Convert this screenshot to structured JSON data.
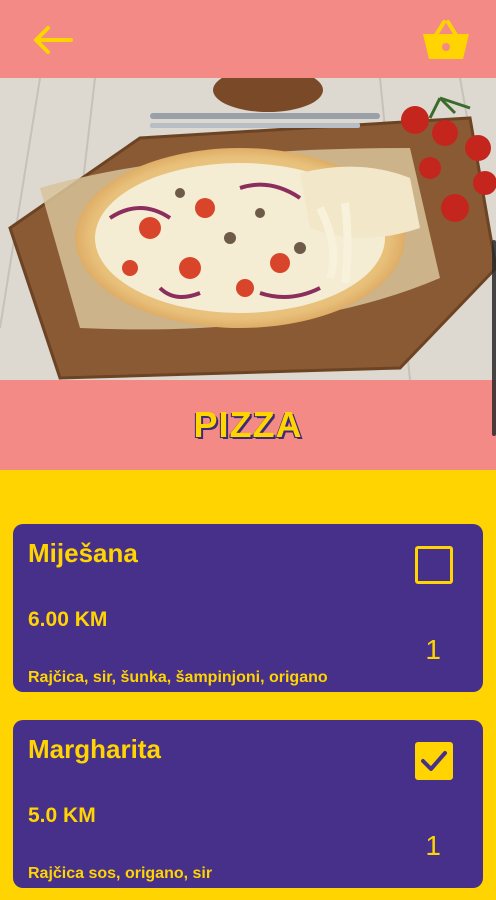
{
  "toolbar": {
    "back_icon": "arrow-left-icon",
    "cart_icon": "basket-icon",
    "accent_color": "#FFD400",
    "bar_color": "#F48A86"
  },
  "hero": {
    "image": "pizza-photo"
  },
  "category": {
    "title": "PIZZA"
  },
  "items": [
    {
      "name": "Miješana",
      "price": "6.00 KM",
      "description": "Rajčica, sir, šunka, šampinjoni, origano",
      "quantity": "1",
      "selected": false
    },
    {
      "name": "Margharita",
      "price": "5.0 KM",
      "description": "Rajčica sos, origano, sir",
      "quantity": "1",
      "selected": true
    }
  ],
  "colors": {
    "background": "#FFD400",
    "card": "#46308A",
    "text": "#FFD400"
  }
}
